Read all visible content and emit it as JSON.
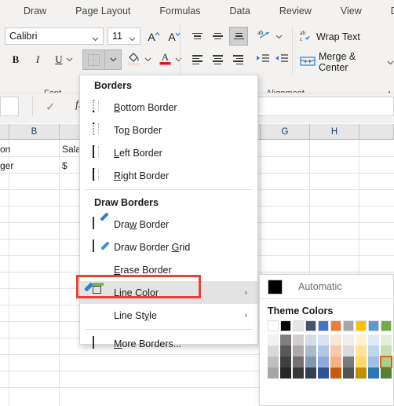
{
  "ribbon": {
    "tabs": [
      "Draw",
      "Page Layout",
      "Formulas",
      "Data",
      "Review",
      "View",
      "Developer"
    ],
    "font_group": {
      "font_name": "Calibri",
      "font_size": "11",
      "grow_font_icon": "A",
      "shrink_font_icon": "A",
      "bold_label": "B",
      "italic_label": "I",
      "underline_label": "U",
      "group_label": "Font"
    },
    "alignment_group": {
      "wrap_text_label": "Wrap Text",
      "merge_center_label": "Merge & Center",
      "group_label": "Alignment",
      "orientation_icon": "ab-angle-icon"
    }
  },
  "formula_bar": {
    "name_box_value": "",
    "formula_value": "",
    "cancel_icon": "✓",
    "function_icon": "fx"
  },
  "grid": {
    "column_headers": [
      "B",
      "",
      "G",
      "H"
    ],
    "cells": [
      {
        "text": "on"
      },
      {
        "text": "ger"
      },
      {
        "text": "Sala"
      },
      {
        "text": "$"
      }
    ]
  },
  "borders_menu": {
    "section_borders_title": "Borders",
    "section_draw_title": "Draw Borders",
    "items": [
      {
        "label": "Bottom Border",
        "icon": "bottom-border-icon",
        "submenu": false
      },
      {
        "label": "Top Border",
        "icon": "top-border-icon",
        "submenu": false
      },
      {
        "label": "Left Border",
        "icon": "left-border-icon",
        "submenu": false
      },
      {
        "label": "Right Border",
        "icon": "right-border-icon",
        "submenu": false
      },
      {
        "label": "Draw Border",
        "icon": "draw-border-icon",
        "submenu": false
      },
      {
        "label": "Draw Border Grid",
        "icon": "draw-border-grid-icon",
        "submenu": false
      },
      {
        "label": "Erase Border",
        "icon": "erase-border-icon",
        "submenu": false
      },
      {
        "label": "Line Color",
        "icon": "line-color-icon",
        "submenu": true
      },
      {
        "label": "Line Style",
        "icon": "",
        "submenu": true
      },
      {
        "label": "More Borders...",
        "icon": "more-borders-icon",
        "submenu": false
      }
    ],
    "highlighted_item": "Line Color",
    "chevron": "›"
  },
  "annotation": {
    "target": "Line Color",
    "color": "#ec4034"
  },
  "color_submenu": {
    "automatic_label": "Automatic",
    "automatic_color": "#000000",
    "theme_colors_title": "Theme Colors",
    "theme_base": [
      "#ffffff",
      "#000000",
      "#e7e6e6",
      "#44546a",
      "#4472c4",
      "#ed7d31",
      "#a5a5a5",
      "#ffc000",
      "#5b9bd5",
      "#70ad47"
    ],
    "theme_variants": [
      [
        "#f2f2f2",
        "#d9d9d9",
        "#bfbfbf",
        "#a6a6a6"
      ],
      [
        "#7f7f7f",
        "#595959",
        "#404040",
        "#262626"
      ],
      [
        "#d0cece",
        "#aeaaaa",
        "#757171",
        "#3b3838"
      ],
      [
        "#d6dce4",
        "#acb9ca",
        "#8497b0",
        "#333f4f"
      ],
      [
        "#d9e2f3",
        "#b4c6e7",
        "#8faadc",
        "#2f5496"
      ],
      [
        "#fbe5d5",
        "#f7caac",
        "#f4b183",
        "#c55a11"
      ],
      [
        "#ededed",
        "#dbdbdb",
        "#7b7b7b",
        "#525252"
      ],
      [
        "#fff2cc",
        "#ffe599",
        "#ffd966",
        "#bf8f00"
      ],
      [
        "#deebf6",
        "#bdd7ee",
        "#9cc3e5",
        "#2e75b5"
      ],
      [
        "#e2efd9",
        "#c5e0b3",
        "#a8d08d",
        "#538135"
      ]
    ],
    "selected_swatch": {
      "column": 9,
      "row": 2,
      "color": "#a8d08d"
    },
    "selection_outline": "#e06020"
  }
}
